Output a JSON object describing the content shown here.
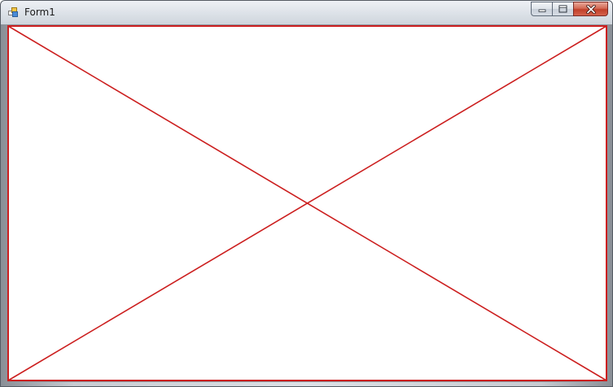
{
  "window": {
    "title": "Form1",
    "icon": "winforms-app-icon"
  },
  "caption_buttons": {
    "minimize_icon": "minimize-icon",
    "maximize_icon": "maximize-icon",
    "close_icon": "close-icon"
  },
  "canvas": {
    "shapes": [
      "rectangle-border",
      "diagonal-line",
      "diagonal-line"
    ],
    "stroke_color": "#cc1f1f"
  }
}
